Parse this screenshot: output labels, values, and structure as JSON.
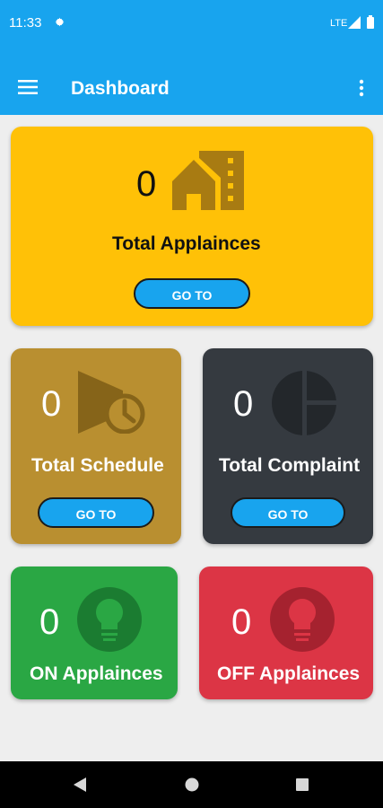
{
  "status_bar": {
    "time": "11:33",
    "network": "LTE"
  },
  "app_bar": {
    "title": "Dashboard",
    "menu_icon": "hamburger-menu-icon",
    "more_icon": "more-vert-icon"
  },
  "cards": {
    "appliances": {
      "count": "0",
      "label": "Total Applainces",
      "button": "GO TO",
      "icon": "home-city-icon",
      "color": "#ffc107"
    },
    "schedule": {
      "count": "0",
      "label": "Total Schedule",
      "button": "GO TO",
      "icon": "schedule-icon",
      "color": "#b98f30"
    },
    "complaint": {
      "count": "0",
      "label": "Total Complaint",
      "button": "GO TO",
      "icon": "pie-chart-icon",
      "color": "#353a40"
    },
    "on": {
      "count": "0",
      "label": "ON Applainces",
      "icon": "bulb-icon",
      "color": "#2aa744"
    },
    "off": {
      "count": "0",
      "label": "OFF Applainces",
      "icon": "bulb-icon",
      "color": "#dc3545"
    }
  },
  "colors": {
    "accent": "#18a4ee",
    "background": "#eeeeee"
  }
}
